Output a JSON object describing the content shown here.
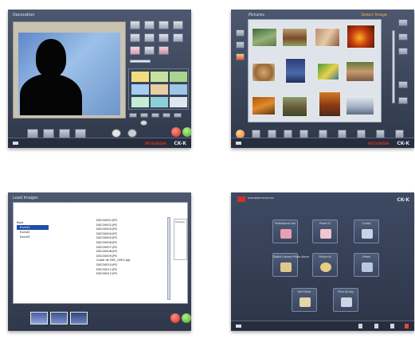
{
  "panel1": {
    "title": "Decoration"
  },
  "panel2": {
    "title": "Pictures",
    "title_right": "Select Image"
  },
  "panel3": {
    "title": "Load Images",
    "tree": [
      "Root",
      "Event1",
      "Event2",
      "Event3"
    ],
    "files": [
      "DSC00001.JPG",
      "DSC00002.JPG",
      "DSC00003.JPG",
      "DSC00004.JPG",
      "DSC00005.JPG",
      "DSC00006.JPG",
      "DSC00007.JPG",
      "DSC00008.JPG",
      "DSC00009.JPG",
      "Copie de DSC_0001.jpg",
      "DSC00010.JPG",
      "DSC00011.JPG",
      "DSC00012.JPG"
    ],
    "preview_label": "Preview"
  },
  "panel4": {
    "brand": "MITSUBISHI ELECTRIC",
    "menu": [
      "Professional Use",
      "Photo ID",
      "Quality",
      "Digital Camera Photo Album",
      "Picture Id",
      "Frame",
      "Self Check",
      "Print All Log"
    ]
  },
  "footer": {
    "logo": "CK-K",
    "brand": "MITSUBISHI"
  }
}
